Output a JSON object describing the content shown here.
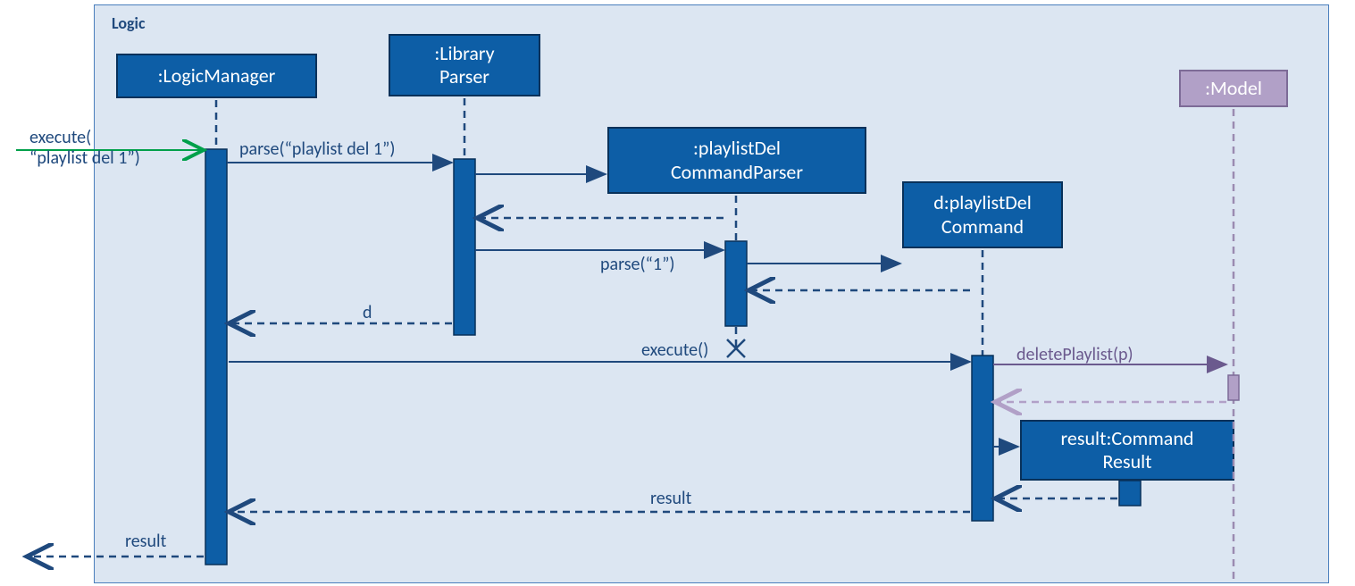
{
  "frame": {
    "label": "Logic"
  },
  "lifelines": {
    "logicmgr": ":LogicManager",
    "libparser": ":Library\nParser",
    "cmdparser": ":playlistDel\nCommandParser",
    "cmd": "d:playlistDel\nCommand",
    "model": ":Model",
    "result": "result:Command\nResult"
  },
  "messages": {
    "entry": "execute(\n“playlist del 1”)",
    "parse_full": "parse(“playlist del 1”)",
    "parse_one": "parse(“1”)",
    "d_return": "d",
    "execute": "execute()",
    "deletePlaylist": "deletePlaylist(p)",
    "result_return": "result",
    "result_out": "result"
  },
  "chart_data": {
    "type": "uml-sequence",
    "frame": "Logic",
    "participants": [
      {
        "id": "logicmgr",
        "name": ":LogicManager",
        "in_frame": true
      },
      {
        "id": "libparser",
        "name": ":LibraryParser",
        "in_frame": true
      },
      {
        "id": "cmdparser",
        "name": ":playlistDelCommandParser",
        "in_frame": true,
        "created": true,
        "destroyed": true
      },
      {
        "id": "cmd",
        "name": "d:playlistDelCommand",
        "in_frame": true,
        "created": true
      },
      {
        "id": "result",
        "name": "result:CommandResult",
        "in_frame": true,
        "created": true
      },
      {
        "id": "model",
        "name": ":Model",
        "in_frame": false
      }
    ],
    "messages": [
      {
        "from": "external",
        "to": "logicmgr",
        "label": "execute(\"playlist del 1\")",
        "kind": "call"
      },
      {
        "from": "logicmgr",
        "to": "libparser",
        "label": "parse(\"playlist del 1\")",
        "kind": "call"
      },
      {
        "from": "libparser",
        "to": "cmdparser",
        "label": "",
        "kind": "create"
      },
      {
        "from": "cmdparser",
        "to": "libparser",
        "label": "",
        "kind": "return"
      },
      {
        "from": "libparser",
        "to": "cmdparser",
        "label": "parse(\"1\")",
        "kind": "call"
      },
      {
        "from": "cmdparser",
        "to": "cmd",
        "label": "",
        "kind": "create"
      },
      {
        "from": "cmd",
        "to": "cmdparser",
        "label": "",
        "kind": "return"
      },
      {
        "from": "libparser",
        "to": "logicmgr",
        "label": "d",
        "kind": "return"
      },
      {
        "from": "cmdparser",
        "to": null,
        "label": "",
        "kind": "destroy"
      },
      {
        "from": "logicmgr",
        "to": "cmd",
        "label": "execute()",
        "kind": "call"
      },
      {
        "from": "cmd",
        "to": "model",
        "label": "deletePlaylist(p)",
        "kind": "call"
      },
      {
        "from": "model",
        "to": "cmd",
        "label": "",
        "kind": "return"
      },
      {
        "from": "cmd",
        "to": "result",
        "label": "",
        "kind": "create"
      },
      {
        "from": "result",
        "to": "cmd",
        "label": "",
        "kind": "return"
      },
      {
        "from": "cmd",
        "to": "logicmgr",
        "label": "result",
        "kind": "return"
      },
      {
        "from": "logicmgr",
        "to": "external",
        "label": "result",
        "kind": "return"
      }
    ]
  }
}
